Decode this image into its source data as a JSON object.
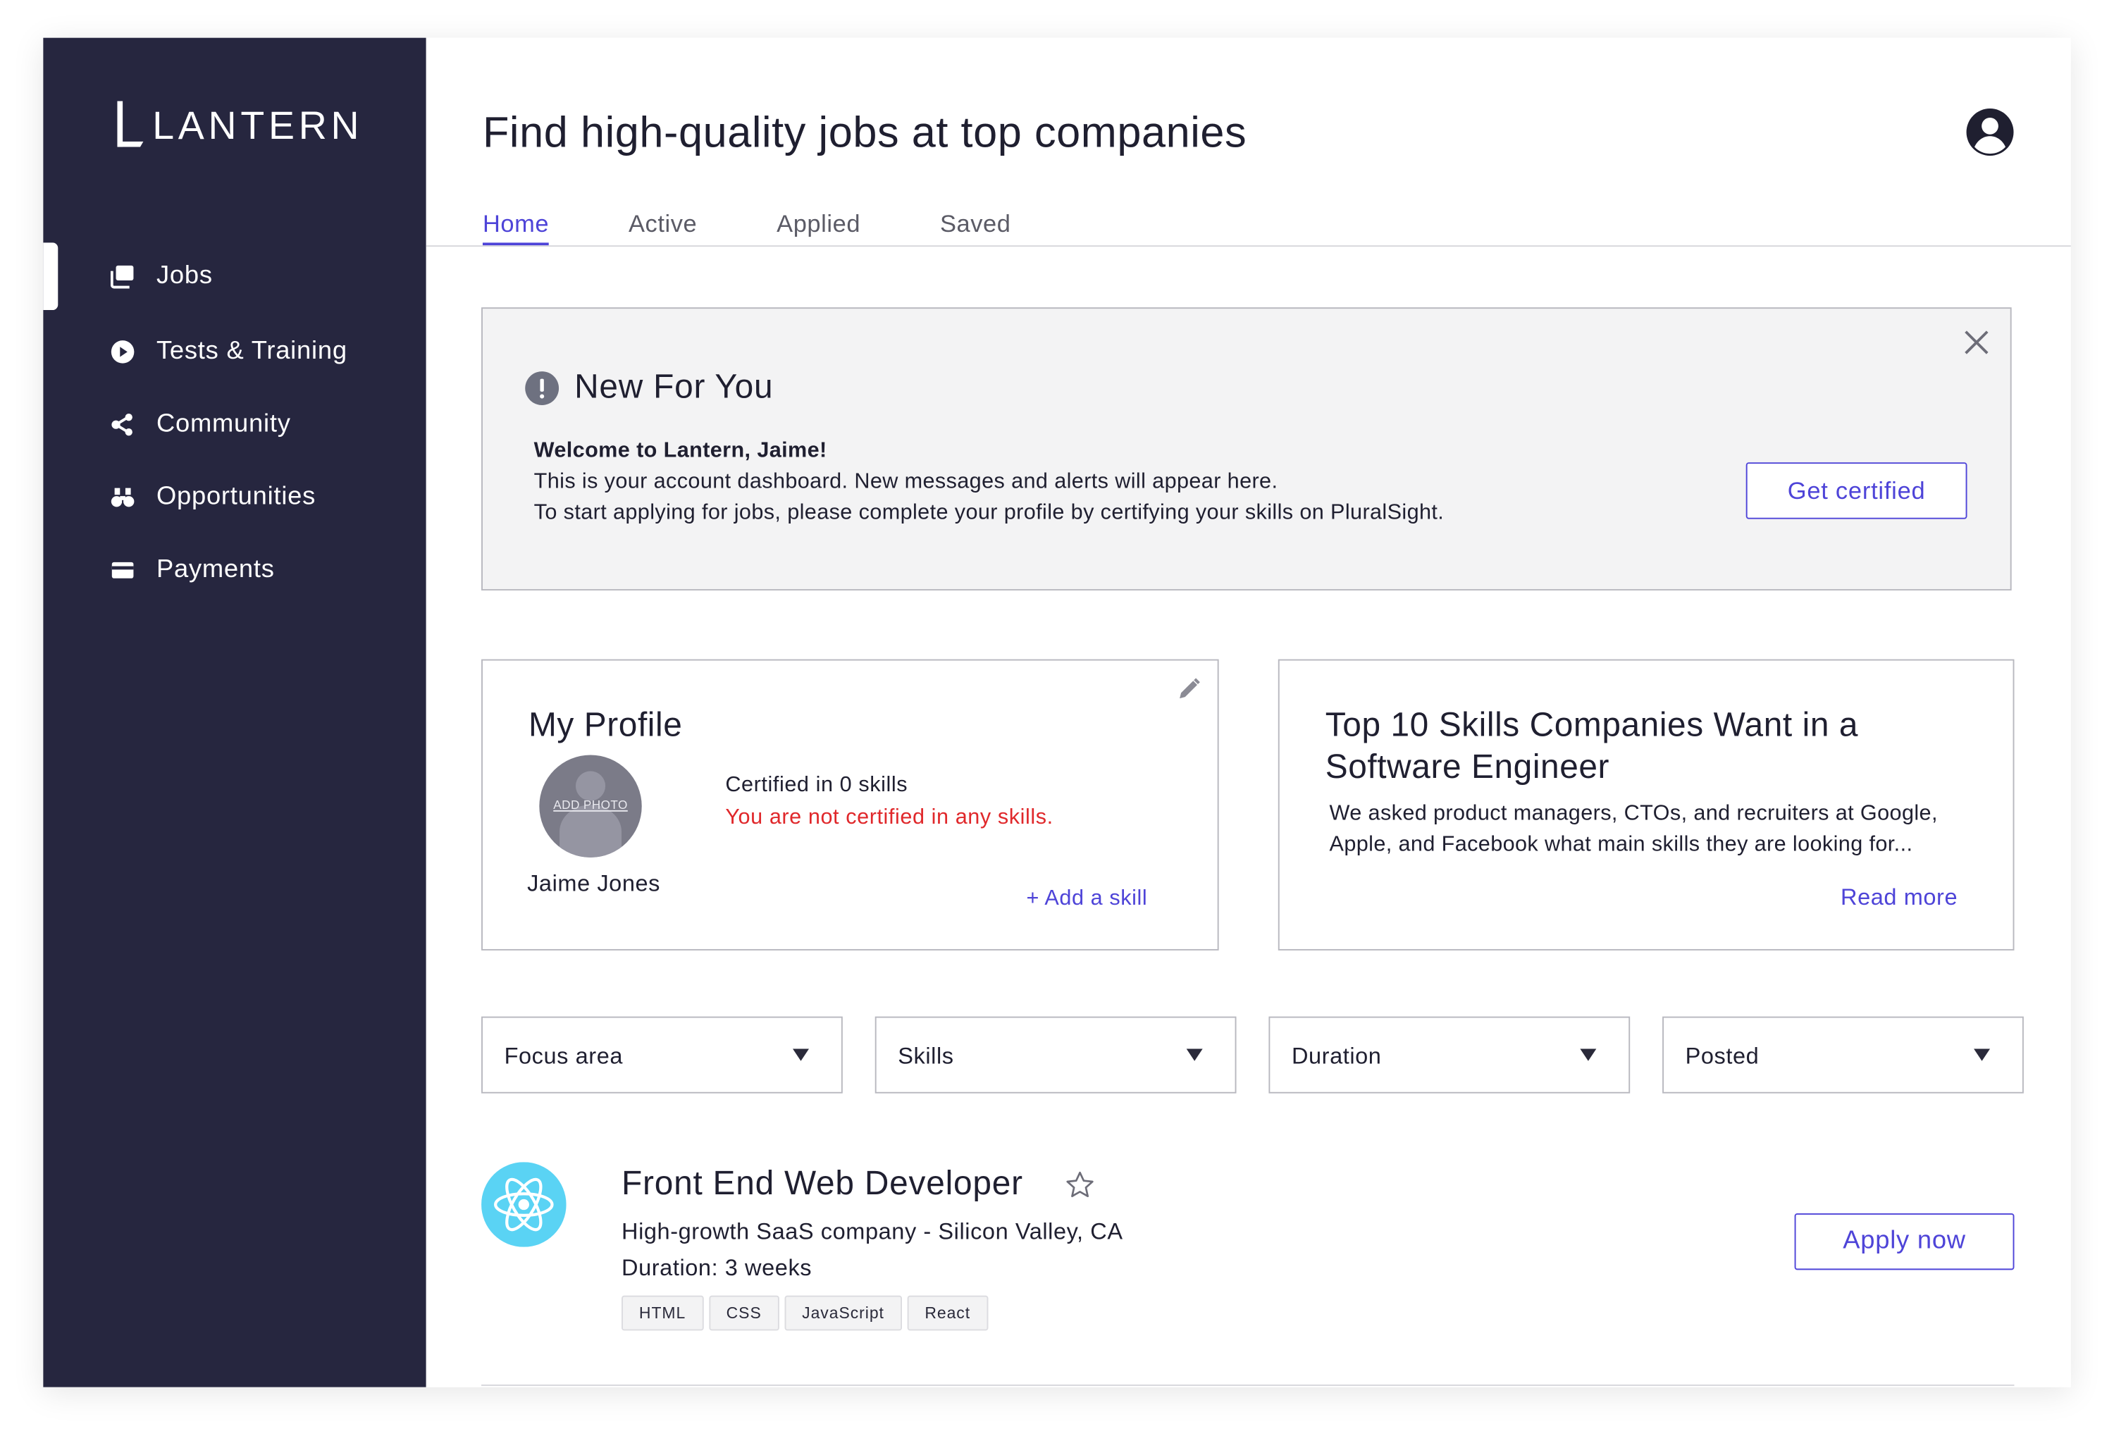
{
  "brand": {
    "name": "LANTERN"
  },
  "sidebar": {
    "items": [
      {
        "label": "Jobs",
        "icon": "jobs-icon",
        "active": true
      },
      {
        "label": "Tests & Training",
        "icon": "play-circle-icon"
      },
      {
        "label": "Community",
        "icon": "share-nodes-icon"
      },
      {
        "label": "Opportunities",
        "icon": "binoculars-icon"
      },
      {
        "label": "Payments",
        "icon": "credit-card-icon"
      }
    ]
  },
  "header": {
    "title": "Find high-quality jobs at top companies",
    "account_icon": "user-circle-icon"
  },
  "tabs": [
    {
      "label": "Home",
      "active": true
    },
    {
      "label": "Active"
    },
    {
      "label": "Applied"
    },
    {
      "label": "Saved"
    }
  ],
  "alert": {
    "title": "New For You",
    "welcome": "Welcome to Lantern, Jaime!",
    "line1": "This is your account dashboard. New messages and alerts will appear here.",
    "line2": "To start applying for jobs, please complete your profile by certifying your skills on PluralSight.",
    "button": "Get certified"
  },
  "profile": {
    "title": "My Profile",
    "photo_label": "ADD PHOTO",
    "name": "Jaime Jones",
    "certified": "Certified in 0 skills",
    "warning": "You are not certified in any skills.",
    "add_skill": "+ Add a skill"
  },
  "article": {
    "title": "Top 10 Skills Companies Want in a Software Engineer",
    "description": "We asked product managers, CTOs, and recruiters at Google, Apple, and Facebook what main skills they are looking for...",
    "read_more": "Read more"
  },
  "filters": [
    {
      "label": "Focus area"
    },
    {
      "label": "Skills"
    },
    {
      "label": "Duration"
    },
    {
      "label": "Posted"
    }
  ],
  "job": {
    "title": "Front End Web Developer",
    "company": "High-growth SaaS company - Silicon Valley, CA",
    "duration": "Duration: 3 weeks",
    "tags": [
      "HTML",
      "CSS",
      "JavaScript",
      "React"
    ],
    "apply": "Apply now",
    "logo_icon": "react-icon"
  },
  "colors": {
    "sidebar": "#26263f",
    "accent": "#4e44d8",
    "warning": "#e0282b",
    "react": "#5ad3f4"
  }
}
